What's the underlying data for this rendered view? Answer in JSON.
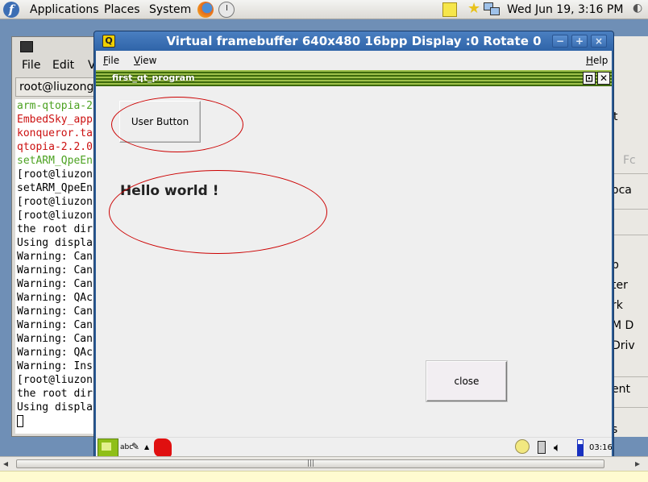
{
  "top_panel": {
    "menus": [
      "Applications",
      "Places",
      "System"
    ],
    "datetime": "Wed Jun 19,  3:16 PM"
  },
  "terminal": {
    "menu": [
      "File",
      "Edit",
      "V"
    ],
    "tab_title": "root@liuzongn",
    "lines": [
      {
        "text": "arm-qtopia-2",
        "color": "green"
      },
      {
        "text": "EmbedSky_app",
        "color": "red"
      },
      {
        "text": "konqueror.ta",
        "color": "red"
      },
      {
        "text": "qtopia-2.2.0",
        "color": "red"
      },
      {
        "text": "setARM_QpeEn",
        "color": "green"
      },
      {
        "text": "[root@liuzon",
        "color": "black"
      },
      {
        "text": "setARM_QpeEn",
        "color": "black"
      },
      {
        "text": "[root@liuzon",
        "color": "black"
      },
      {
        "text": "[root@liuzon",
        "color": "black"
      },
      {
        "text": "the root dir",
        "color": "black"
      },
      {
        "text": "Using displa",
        "color": "black"
      },
      {
        "text": "Warning: Can",
        "color": "black"
      },
      {
        "text": "Warning: Can",
        "color": "black"
      },
      {
        "text": "Warning: Can",
        "color": "black"
      },
      {
        "text": "Warning: QAc",
        "color": "black"
      },
      {
        "text": "Warning: Can",
        "color": "black"
      },
      {
        "text": "Warning: Can",
        "color": "black"
      },
      {
        "text": "Warning: Can",
        "color": "black"
      },
      {
        "text": "Warning: QAc",
        "color": "black"
      },
      {
        "text": "Warning: Ins",
        "color": "black"
      },
      {
        "text": "[root@liuzon",
        "color": "black"
      },
      {
        "text": "the root dir",
        "color": "black"
      },
      {
        "text": "Using displa",
        "color": "black"
      }
    ]
  },
  "right_window": {
    "fragments": [
      "t",
      "Fc",
      "oca",
      "p",
      "ter",
      "rk",
      "M D",
      "Driv",
      "ent",
      "s"
    ]
  },
  "qvfb": {
    "title": "Virtual framebuffer 640x480 16bpp Display :0 Rotate 0",
    "icon_letter": "Q",
    "menu_file": "File",
    "menu_view": "View",
    "menu_help": "Help",
    "wm_buttons": [
      "−",
      "+",
      "×"
    ]
  },
  "qt_app": {
    "title": "first_qt_program",
    "user_button_label": "User Button",
    "hello_text": "Hello world !",
    "close_button_label": "close"
  },
  "qt_taskbar": {
    "ime_label": "abc",
    "time": "03:16"
  },
  "colors": {
    "annotation": "#cc0000",
    "qt_titlebar": "#3d6a0c",
    "qvfb_titlebar": "#2f64a8"
  }
}
